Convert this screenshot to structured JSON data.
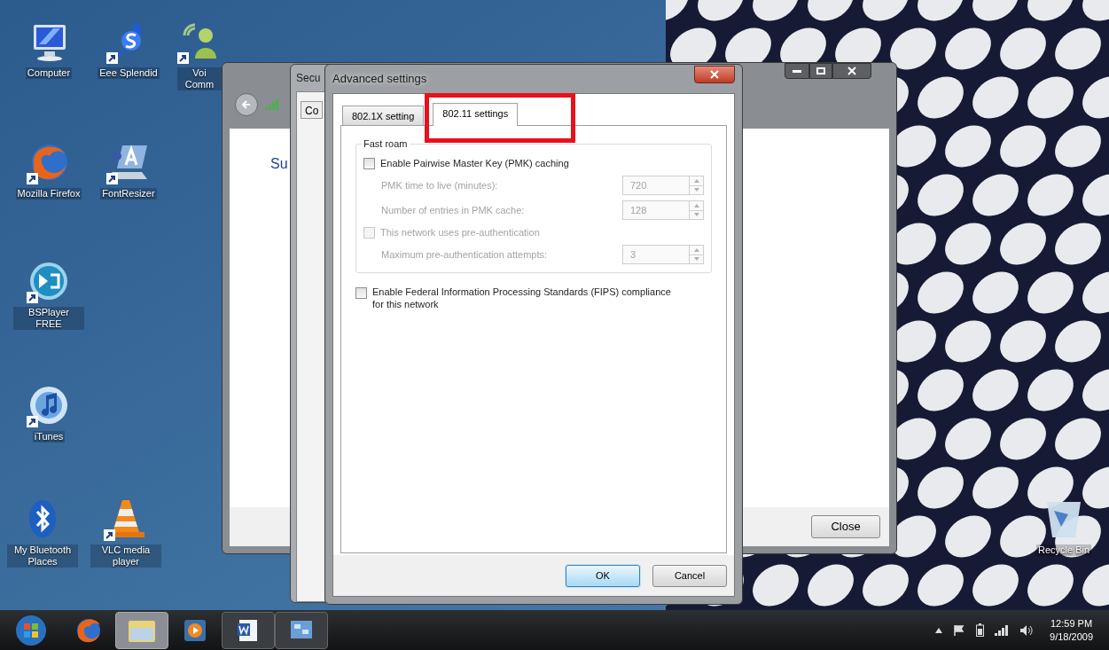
{
  "desktop_icons": [
    {
      "kind": "computer",
      "label": "Computer"
    },
    {
      "kind": "splendid",
      "label": "Eee Splendid"
    },
    {
      "kind": "voice",
      "label": "Voi Comm"
    },
    {
      "kind": "firefox",
      "label": "Mozilla Firefox"
    },
    {
      "kind": "fontresizer",
      "label": "FontResizer"
    },
    {
      "kind": "bsplayer",
      "label": "BSPlayer FREE"
    },
    {
      "kind": "itunes",
      "label": "iTunes"
    },
    {
      "kind": "bluetooth",
      "label": "My Bluetooth Places"
    },
    {
      "kind": "vlc",
      "label": "VLC media player"
    },
    {
      "kind": "recycle",
      "label": "Recycle Bin"
    }
  ],
  "back_window": {
    "heading": "Su",
    "close_button": "Close"
  },
  "middle_window": {
    "title": "Secu",
    "tab": "Co"
  },
  "dialog": {
    "title": "Advanced settings",
    "tabs": [
      {
        "label": "802.1X setting",
        "selected": false
      },
      {
        "label": "802.11 settings",
        "selected": true
      }
    ],
    "group_title": "Fast roam",
    "items": [
      {
        "kind": "checkbox",
        "label": "Enable Pairwise Master Key (PMK) caching",
        "checked": false,
        "disabled": false
      },
      {
        "kind": "spinner",
        "label": "PMK time to live (minutes):",
        "value": "720",
        "disabled": true
      },
      {
        "kind": "spinner",
        "label": "Number of entries in PMK cache:",
        "value": "128",
        "disabled": true
      },
      {
        "kind": "checkbox",
        "label": "This network uses pre-authentication",
        "checked": false,
        "disabled": true
      },
      {
        "kind": "spinner",
        "label": "Maximum pre-authentication attempts:",
        "value": "3",
        "disabled": true
      }
    ],
    "fips": {
      "label": "Enable Federal Information Processing Standards (FIPS) compliance for this network",
      "checked": false
    },
    "buttons": [
      {
        "label": "OK",
        "default": true
      },
      {
        "label": "Cancel",
        "default": false
      }
    ]
  },
  "taskbar": {
    "time": "12:59 PM",
    "date": "9/18/2009"
  }
}
